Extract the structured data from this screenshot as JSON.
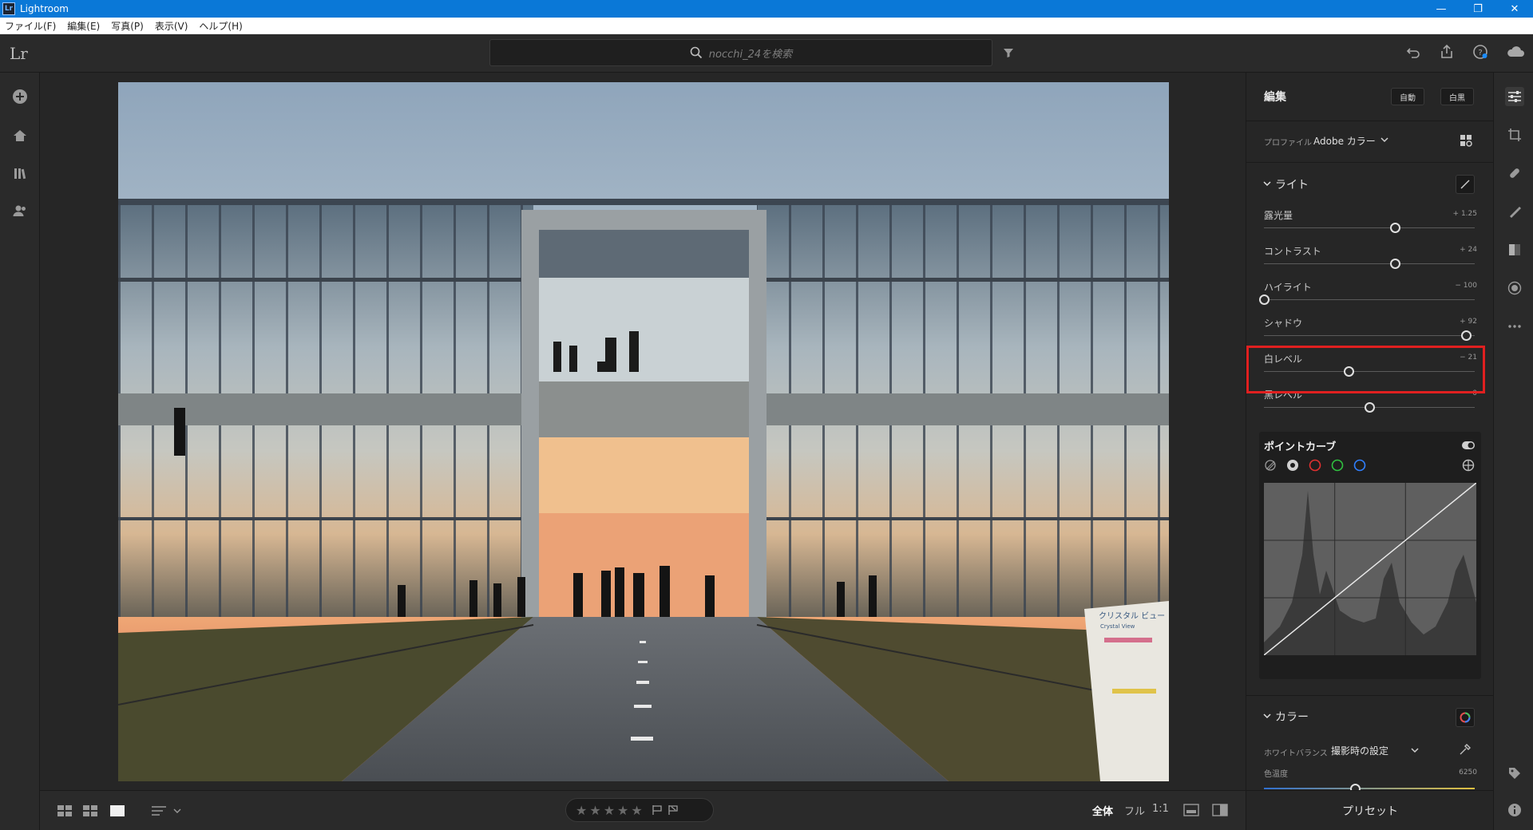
{
  "window": {
    "app_icon": "Lr",
    "title": "Lightroom",
    "minimize": "—",
    "restore": "❐",
    "close": "✕"
  },
  "menu": [
    "ファイル(F)",
    "編集(E)",
    "写真(P)",
    "表示(V)",
    "ヘルプ(H)"
  ],
  "toolbar": {
    "logo": "Lr",
    "search_placeholder": "nocchi_24を検索"
  },
  "edit_panel": {
    "title": "編集",
    "auto_button": "自動",
    "bw_button": "白黒",
    "profile_label": "プロファイル",
    "profile_value": "Adobe カラー",
    "light_section": "ライト",
    "sliders": [
      {
        "label": "露光量",
        "value": "+ 1.25",
        "position": 0.62
      },
      {
        "label": "コントラスト",
        "value": "+ 24",
        "position": 0.62
      },
      {
        "label": "ハイライト",
        "value": "− 100",
        "position": 0.0
      },
      {
        "label": "シャドウ",
        "value": "+ 92",
        "position": 0.96
      },
      {
        "label": "白レベル",
        "value": "− 21",
        "position": 0.4
      },
      {
        "label": "黒レベル",
        "value": "0",
        "position": 0.5
      }
    ],
    "point_curve_title": "ポイントカーブ",
    "color_section": "カラー",
    "white_balance_label": "ホワイトバランス",
    "white_balance_value": "撮影時の設定",
    "temp_label": "色温度",
    "temp_value": "6250",
    "temp_position": 0.43,
    "presets_button": "プリセット"
  },
  "bottom": {
    "stars": [
      "★",
      "★",
      "★",
      "★",
      "★"
    ],
    "zoom_all": "全体",
    "zoom_full": "フル",
    "zoom_1to1": "1:1"
  },
  "photo_sign": {
    "title": "クリスタル ビュー",
    "subtitle": "Crystal View"
  },
  "colors": {
    "accent": "#0a78d7",
    "highlight_box": "#e02020",
    "panel_bg": "#262626"
  }
}
